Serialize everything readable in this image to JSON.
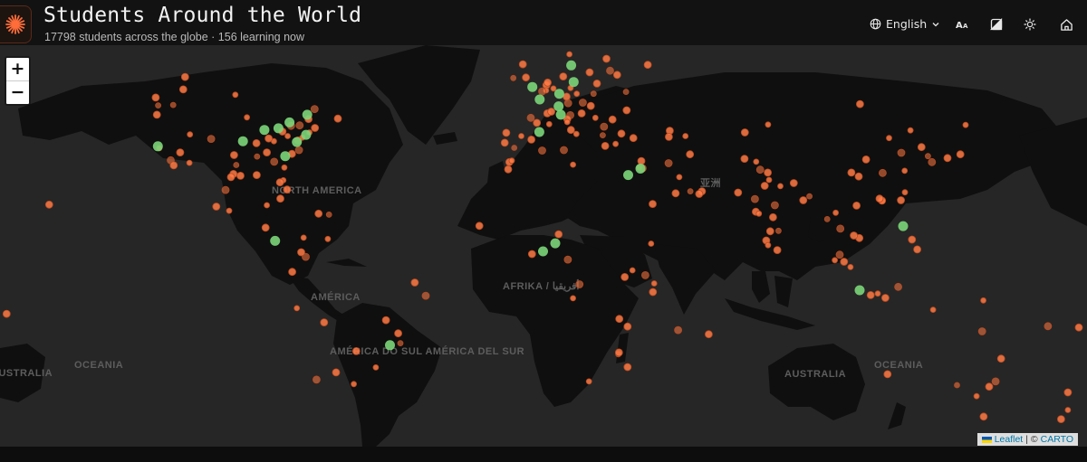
{
  "header": {
    "title": "Students Around the World",
    "subtitle": "17798 students across the globe · 156 learning now",
    "language": "English",
    "accent_color": "#ff6d3a"
  },
  "icons": {
    "logo": "asterisk-logo-icon",
    "language": "globe-icon",
    "font_size": "font-size-icon",
    "theme": "contrast-icon",
    "brightness": "sun-icon",
    "home": "home-icon"
  },
  "zoom": {
    "in_label": "+",
    "out_label": "−"
  },
  "attribution": {
    "leaflet": "Leaflet",
    "sep": " | © ",
    "carto": "CARTO"
  },
  "map_labels": [
    "NORTH AMERICA",
    "AMÉRICA",
    "AFRIKA / أفريقيا",
    "亚洲",
    "AMÉRICA DO SUL AMÉRICA DEL SUR",
    "OCEANIA",
    "AUSTRALIA",
    "AUSTRALIA",
    "OCEANIA"
  ],
  "markers": {
    "orange_color": "#ff7b45",
    "green_color": "#7cd67a",
    "green": [
      [
        40.7,
        -74.0
      ],
      [
        38.9,
        -77.0
      ],
      [
        42.3,
        -83.0
      ],
      [
        39.1,
        -94.6
      ],
      [
        45.5,
        -73.6
      ],
      [
        43.7,
        -79.4
      ],
      [
        35.2,
        -80.8
      ],
      [
        41.9,
        -87.6
      ],
      [
        37.8,
        -122.4
      ],
      [
        9.9,
        -84.1
      ],
      [
        51.5,
        -0.1
      ],
      [
        48.9,
        2.3
      ],
      [
        52.5,
        13.4
      ],
      [
        50.1,
        8.7
      ],
      [
        47.4,
        8.5
      ],
      [
        41.4,
        2.2
      ],
      [
        45.5,
        9.2
      ],
      [
        59.3,
        18.1
      ],
      [
        55.7,
        12.6
      ],
      [
        31.8,
        35.2
      ],
      [
        30.0,
        31.2
      ],
      [
        6.5,
        3.4
      ],
      [
        9.1,
        7.4
      ],
      [
        -23.5,
        -46.6
      ],
      [
        14.6,
        121.0
      ],
      [
        -6.2,
        106.8
      ]
    ],
    "orange": [
      [
        47.6,
        -122.3
      ],
      [
        45.5,
        -122.7
      ],
      [
        49.3,
        -123.1
      ],
      [
        37.3,
        -121.9
      ],
      [
        34.1,
        -118.2
      ],
      [
        32.7,
        -117.2
      ],
      [
        33.4,
        -112.1
      ],
      [
        36.2,
        -115.1
      ],
      [
        39.7,
        -105.0
      ],
      [
        40.8,
        -111.9
      ],
      [
        30.3,
        -97.7
      ],
      [
        29.8,
        -95.4
      ],
      [
        32.8,
        -96.8
      ],
      [
        29.4,
        -98.5
      ],
      [
        25.8,
        -80.2
      ],
      [
        28.5,
        -81.4
      ],
      [
        33.7,
        -84.4
      ],
      [
        36.2,
        -86.8
      ],
      [
        39.1,
        -84.5
      ],
      [
        42.4,
        -71.1
      ],
      [
        43.0,
        -76.1
      ],
      [
        44.9,
        -93.3
      ],
      [
        38.6,
        -90.2
      ],
      [
        35.5,
        -97.5
      ],
      [
        47.7,
        -117.4
      ],
      [
        51.0,
        -114.1
      ],
      [
        53.5,
        -113.5
      ],
      [
        49.9,
        -97.1
      ],
      [
        46.8,
        -71.2
      ],
      [
        44.6,
        -63.6
      ],
      [
        19.4,
        -99.1
      ],
      [
        20.7,
        -103.3
      ],
      [
        25.7,
        -100.3
      ],
      [
        21.1,
        -86.8
      ],
      [
        23.1,
        -82.4
      ],
      [
        18.5,
        -69.9
      ],
      [
        18.2,
        -66.5
      ],
      [
        21.3,
        -157.9
      ],
      [
        14.1,
        -87.2
      ],
      [
        10.5,
        -66.9
      ],
      [
        4.7,
        -74.1
      ],
      [
        -0.2,
        -78.5
      ],
      [
        -12.0,
        -77.0
      ],
      [
        -16.5,
        -68.1
      ],
      [
        -33.4,
        -70.6
      ],
      [
        -34.6,
        -58.4
      ],
      [
        -31.4,
        -64.2
      ],
      [
        -25.3,
        -57.6
      ],
      [
        -22.9,
        -43.2
      ],
      [
        -19.9,
        -43.9
      ],
      [
        -15.8,
        -47.9
      ],
      [
        -30.0,
        -51.2
      ],
      [
        -8.0,
        -34.9
      ],
      [
        -3.7,
        -38.5
      ],
      [
        10.9,
        -74.8
      ],
      [
        6.2,
        -75.6
      ],
      [
        39.3,
        -76.6
      ],
      [
        40.0,
        -75.2
      ],
      [
        41.5,
        -81.7
      ],
      [
        39.8,
        -86.2
      ],
      [
        35.1,
        -90.0
      ],
      [
        30.0,
        -90.1
      ],
      [
        27.9,
        -82.5
      ],
      [
        32.1,
        -81.1
      ],
      [
        36.8,
        -76.3
      ],
      [
        35.8,
        -78.6
      ],
      [
        41.3,
        -72.9
      ],
      [
        44.5,
        -73.2
      ],
      [
        42.9,
        -78.9
      ],
      [
        40.4,
        -80.0
      ],
      [
        53.4,
        -2.2
      ],
      [
        55.9,
        -3.2
      ],
      [
        53.3,
        -6.3
      ],
      [
        51.9,
        4.5
      ],
      [
        52.4,
        4.9
      ],
      [
        50.8,
        4.4
      ],
      [
        50.6,
        3.1
      ],
      [
        45.8,
        4.8
      ],
      [
        43.3,
        5.4
      ],
      [
        43.6,
        1.4
      ],
      [
        44.8,
        -0.6
      ],
      [
        40.4,
        -3.7
      ],
      [
        38.7,
        -9.1
      ],
      [
        41.2,
        -8.6
      ],
      [
        37.4,
        -6.0
      ],
      [
        39.5,
        -0.4
      ],
      [
        41.9,
        12.5
      ],
      [
        40.9,
        14.3
      ],
      [
        45.4,
        12.3
      ],
      [
        44.5,
        11.3
      ],
      [
        43.8,
        11.3
      ],
      [
        46.2,
        6.1
      ],
      [
        48.2,
        16.4
      ],
      [
        50.1,
        14.4
      ],
      [
        47.5,
        19.0
      ],
      [
        52.2,
        21.0
      ],
      [
        50.1,
        19.9
      ],
      [
        54.4,
        18.6
      ],
      [
        53.6,
        10.0
      ],
      [
        51.2,
        6.8
      ],
      [
        48.1,
        11.6
      ],
      [
        49.5,
        11.1
      ],
      [
        51.3,
        12.4
      ],
      [
        44.4,
        26.1
      ],
      [
        42.7,
        23.3
      ],
      [
        44.8,
        20.5
      ],
      [
        45.8,
        16.0
      ],
      [
        37.9,
        23.7
      ],
      [
        40.6,
        22.9
      ],
      [
        41.0,
        29.0
      ],
      [
        39.9,
        32.9
      ],
      [
        38.4,
        27.1
      ],
      [
        60.2,
        24.9
      ],
      [
        59.9,
        10.8
      ],
      [
        57.7,
        12.0
      ],
      [
        56.9,
        24.1
      ],
      [
        54.7,
        25.3
      ],
      [
        59.4,
        24.8
      ],
      [
        55.8,
        37.6
      ],
      [
        59.9,
        30.3
      ],
      [
        50.5,
        30.5
      ],
      [
        46.5,
        30.7
      ],
      [
        53.9,
        27.6
      ],
      [
        64.1,
        -21.9
      ],
      [
        36.8,
        10.2
      ],
      [
        33.6,
        -7.6
      ],
      [
        34.0,
        -6.8
      ],
      [
        31.6,
        -8.0
      ],
      [
        36.7,
        3.1
      ],
      [
        32.9,
        13.2
      ],
      [
        25.3,
        55.3
      ],
      [
        24.5,
        54.4
      ],
      [
        25.3,
        51.5
      ],
      [
        24.7,
        46.7
      ],
      [
        21.5,
        39.2
      ],
      [
        29.4,
        47.9
      ],
      [
        33.3,
        44.4
      ],
      [
        35.7,
        51.4
      ],
      [
        32.1,
        34.8
      ],
      [
        33.9,
        35.5
      ],
      [
        31.9,
        35.9
      ],
      [
        40.4,
        49.9
      ],
      [
        41.7,
        44.8
      ],
      [
        40.2,
        44.5
      ],
      [
        67.0,
        37.0
      ],
      [
        14.7,
        -17.4
      ],
      [
        5.6,
        -0.2
      ],
      [
        9.0,
        38.7
      ],
      [
        -1.3,
        36.8
      ],
      [
        -6.8,
        39.3
      ],
      [
        0.3,
        32.6
      ],
      [
        -1.9,
        30.1
      ],
      [
        -4.3,
        15.3
      ],
      [
        -8.8,
        13.2
      ],
      [
        -15.4,
        28.3
      ],
      [
        -17.8,
        31.0
      ],
      [
        -26.2,
        28.0
      ],
      [
        -25.7,
        28.2
      ],
      [
        -29.9,
        31.0
      ],
      [
        -33.9,
        18.4
      ],
      [
        -18.9,
        47.5
      ],
      [
        -20.2,
        57.5
      ],
      [
        -4.0,
        39.7
      ],
      [
        12.0,
        8.5
      ],
      [
        3.8,
        11.5
      ],
      [
        28.6,
        77.2
      ],
      [
        19.1,
        72.9
      ],
      [
        12.97,
        77.6
      ],
      [
        13.1,
        80.3
      ],
      [
        17.4,
        78.5
      ],
      [
        22.6,
        88.4
      ],
      [
        18.5,
        73.9
      ],
      [
        23.0,
        72.6
      ],
      [
        26.9,
        75.8
      ],
      [
        26.8,
        80.9
      ],
      [
        30.7,
        76.8
      ],
      [
        31.5,
        74.3
      ],
      [
        33.7,
        73.0
      ],
      [
        24.9,
        67.1
      ],
      [
        27.7,
        85.3
      ],
      [
        23.8,
        90.4
      ],
      [
        6.9,
        79.9
      ],
      [
        10.0,
        76.3
      ],
      [
        8.5,
        76.9
      ],
      [
        21.1,
        79.1
      ],
      [
        34.5,
        69.2
      ],
      [
        43.2,
        76.9
      ],
      [
        41.3,
        69.3
      ],
      [
        13.8,
        100.5
      ],
      [
        18.8,
        99.0
      ],
      [
        21.0,
        105.8
      ],
      [
        10.8,
        106.7
      ],
      [
        16.8,
        96.2
      ],
      [
        11.6,
        104.9
      ],
      [
        3.1,
        101.7
      ],
      [
        1.35,
        103.8
      ],
      [
        5.4,
        100.3
      ],
      [
        -7.8,
        110.4
      ],
      [
        -7.3,
        112.7
      ],
      [
        -8.7,
        115.2
      ],
      [
        -5.1,
        119.4
      ],
      [
        3.6,
        98.7
      ],
      [
        10.3,
        123.9
      ],
      [
        7.1,
        125.6
      ],
      [
        22.3,
        114.2
      ],
      [
        22.5,
        114.1
      ],
      [
        23.1,
        113.3
      ],
      [
        31.2,
        121.5
      ],
      [
        30.6,
        114.3
      ],
      [
        30.7,
        104.1
      ],
      [
        39.9,
        116.4
      ],
      [
        34.3,
        108.9
      ],
      [
        36.1,
        120.4
      ],
      [
        25.0,
        121.6
      ],
      [
        22.6,
        120.3
      ],
      [
        37.6,
        127.0
      ],
      [
        35.2,
        129.1
      ],
      [
        35.7,
        139.7
      ],
      [
        34.7,
        135.5
      ],
      [
        43.1,
        141.4
      ],
      [
        33.6,
        130.4
      ],
      [
        29.6,
        106.5
      ],
      [
        41.8,
        123.4
      ],
      [
        47.9,
        106.9
      ],
      [
        -33.9,
        151.2
      ],
      [
        -37.8,
        145.0
      ],
      [
        -27.5,
        153.0
      ],
      [
        -31.9,
        115.9
      ],
      [
        -34.9,
        138.6
      ],
      [
        -35.3,
        149.1
      ],
      [
        -42.9,
        147.3
      ],
      [
        -12.5,
        130.8
      ],
      [
        -19.3,
        146.8
      ],
      [
        -36.8,
        174.8
      ],
      [
        -41.3,
        174.8
      ],
      [
        -43.5,
        172.6
      ],
      [
        -17.7,
        168.3
      ],
      [
        -9.5,
        147.2
      ],
      [
        -18.1,
        178.4
      ],
      [
        -13.8,
        -171.8
      ]
    ]
  }
}
